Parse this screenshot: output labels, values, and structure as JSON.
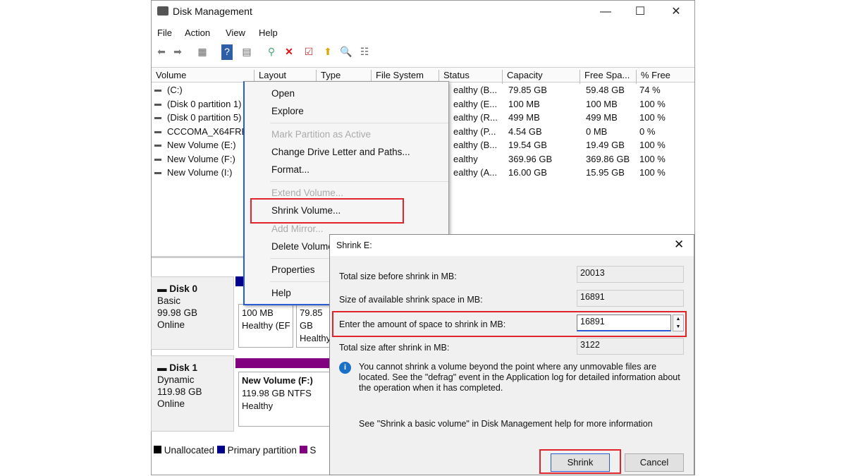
{
  "window": {
    "title": "Disk Management",
    "minimize": "—",
    "maximize": "☐",
    "close": "✕"
  },
  "menu": [
    "File",
    "Action",
    "View",
    "Help"
  ],
  "toolbar_icons": [
    "back-icon",
    "forward-icon",
    "properties-icon",
    "help-icon",
    "console-icon",
    "connect-icon",
    "delete-icon",
    "check-icon",
    "up-icon",
    "search-icon",
    "list-icon"
  ],
  "columns": [
    "Volume",
    "Layout",
    "Type",
    "File System",
    "Status",
    "Capacity",
    "Free Spa...",
    "% Free"
  ],
  "volumes": [
    {
      "name": "(C:)",
      "status": "ealthy (B...",
      "capacity": "79.85 GB",
      "free": "59.48 GB",
      "pct": "74 %"
    },
    {
      "name": "(Disk 0 partition 1)",
      "status": "ealthy (E...",
      "capacity": "100 MB",
      "free": "100 MB",
      "pct": "100 %"
    },
    {
      "name": "(Disk 0 partition 5)",
      "status": "ealthy (R...",
      "capacity": "499 MB",
      "free": "499 MB",
      "pct": "100 %"
    },
    {
      "name": "CCCOMA_X64FRE",
      "status": "ealthy (P...",
      "capacity": "4.54 GB",
      "free": "0 MB",
      "pct": "0 %"
    },
    {
      "name": "New Volume (E:)",
      "status": "ealthy (B...",
      "capacity": "19.54 GB",
      "free": "19.49 GB",
      "pct": "100 %"
    },
    {
      "name": "New Volume (F:)",
      "status": "ealthy",
      "capacity": "369.96 GB",
      "free": "369.86 GB",
      "pct": "100 %"
    },
    {
      "name": "New Volume (I:)",
      "status": "ealthy (A...",
      "capacity": "16.00 GB",
      "free": "15.95 GB",
      "pct": "100 %"
    }
  ],
  "context_menu": {
    "open": "Open",
    "explore": "Explore",
    "mark_active": "Mark Partition as Active",
    "change_letter": "Change Drive Letter and Paths...",
    "format": "Format...",
    "extend": "Extend Volume...",
    "shrink": "Shrink Volume...",
    "add_mirror": "Add Mirror...",
    "delete": "Delete Volume...",
    "properties": "Properties",
    "help": "Help"
  },
  "disks": [
    {
      "name": "Disk 0",
      "type": "Basic",
      "size": "99.98 GB",
      "state": "Online",
      "partitions": [
        {
          "size": "100 MB",
          "status": "Healthy (EFI"
        },
        {
          "size": "79.85 GB",
          "status": "Healthy"
        }
      ]
    },
    {
      "name": "Disk 1",
      "type": "Dynamic",
      "size": "119.98 GB",
      "state": "Online",
      "partitions": [
        {
          "title": "New Volume  (F:)",
          "size": "119.98 GB NTFS",
          "status": "Healthy"
        }
      ]
    }
  ],
  "legend": [
    {
      "label": "Unallocated",
      "color": "#000000"
    },
    {
      "label": "Primary partition",
      "color": "#00008b"
    },
    {
      "label": "S",
      "color": "#800080"
    }
  ],
  "dialog": {
    "title": "Shrink E:",
    "total_before_label": "Total size before shrink in MB:",
    "total_before": "20013",
    "available_label": "Size of available shrink space in MB:",
    "available": "16891",
    "amount_label": "Enter the amount of space to shrink in MB:",
    "amount": "16891",
    "after_label": "Total size after shrink in MB:",
    "after": "3122",
    "info": "You cannot shrink a volume beyond the point where any unmovable files are located. See the \"defrag\" event in the Application log for detailed information about the operation when it has completed.",
    "help": "See \"Shrink a basic volume\" in Disk Management help for more information",
    "shrink": "Shrink",
    "cancel": "Cancel"
  },
  "highlight_color": "#e0242a"
}
